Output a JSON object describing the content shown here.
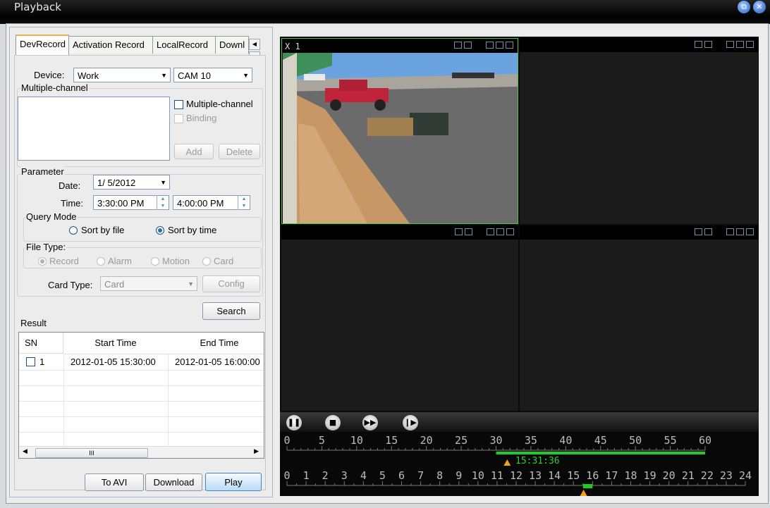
{
  "window": {
    "title": "Playback"
  },
  "tabs": [
    "DevRecord",
    "Activation Record",
    "LocalRecord",
    "Downl"
  ],
  "device": {
    "label": "Device:",
    "value": "Work",
    "camera": "CAM 10"
  },
  "multi": {
    "group_label": "Multiple-channel",
    "chk_multi": "Multiple-channel",
    "chk_binding": "Binding",
    "add": "Add",
    "delete": "Delete"
  },
  "parameter": {
    "group_label": "Parameter",
    "date_label": "Date:",
    "date_value": "1/ 5/2012",
    "time_label": "Time:",
    "time_start": "3:30:00 PM",
    "time_end": "4:00:00 PM",
    "query_mode_label": "Query Mode",
    "sort_file": "Sort by file",
    "sort_time": "Sort by time",
    "file_type_label": "File Type:",
    "ft_record": "Record",
    "ft_alarm": "Alarm",
    "ft_motion": "Motion",
    "ft_card": "Card",
    "card_type_label": "Card Type:",
    "card_type_value": "Card",
    "config": "Config"
  },
  "search_label": "Search",
  "result": {
    "label": "Result",
    "columns": [
      "SN",
      "Start Time",
      "End Time"
    ],
    "rows": [
      {
        "sn": "1",
        "start": "2012-01-05 15:30:00",
        "end": "2012-01-05 16:00:00"
      }
    ],
    "scroll_glyph": "III"
  },
  "bottom_buttons": {
    "to_avi": "To AVI",
    "download": "Download",
    "play": "Play"
  },
  "video": {
    "label": "X 1"
  },
  "timeline": {
    "minutes": [
      "0",
      "5",
      "10",
      "15",
      "20",
      "25",
      "30",
      "35",
      "40",
      "45",
      "50",
      "55",
      "60"
    ],
    "hours": [
      "0",
      "1",
      "2",
      "3",
      "4",
      "5",
      "6",
      "7",
      "8",
      "9",
      "10",
      "11",
      "12",
      "13",
      "14",
      "15",
      "16",
      "17",
      "18",
      "19",
      "20",
      "21",
      "22",
      "23",
      "24"
    ],
    "cursor_time": "15:31:36"
  },
  "colors": {
    "accent_green": "#22cc22",
    "marker_orange": "#f2a21a",
    "play_blue": "#3f84c4"
  }
}
